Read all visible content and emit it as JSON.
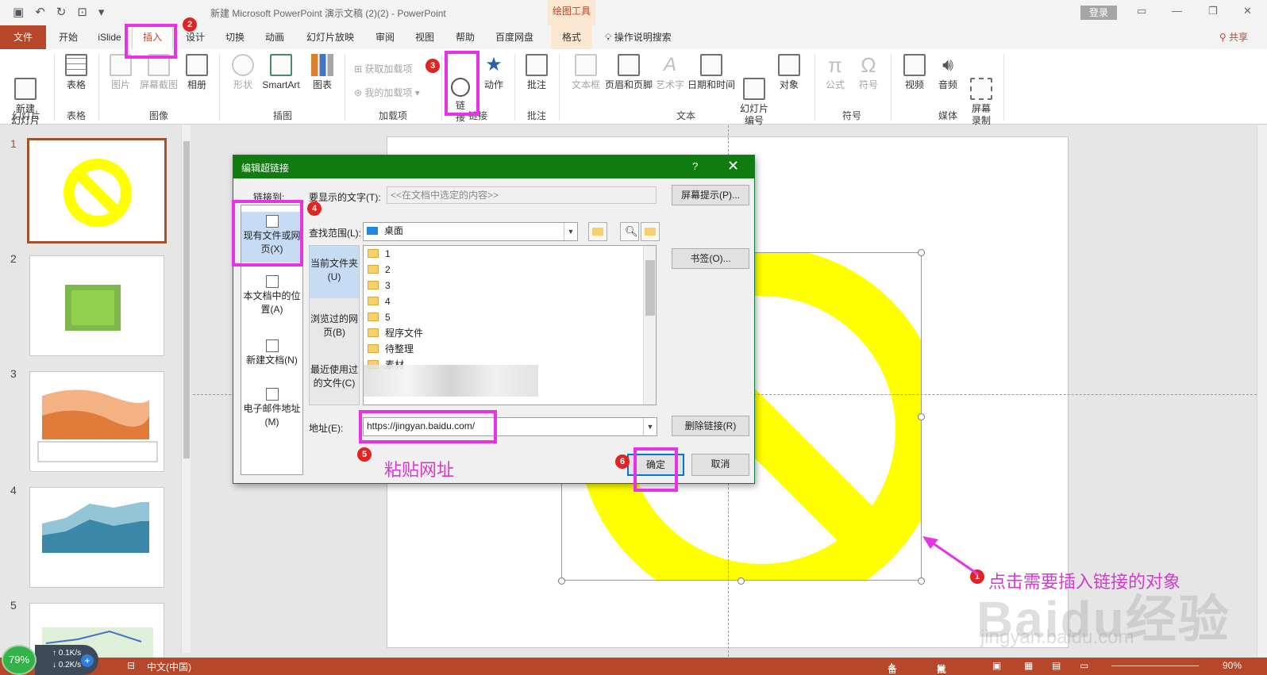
{
  "titlebar": {
    "title": "新建 Microsoft PowerPoint 演示文稿 (2)(2)  -  PowerPoint",
    "context_tab": "绘图工具",
    "login": "登录"
  },
  "tabs": [
    "文件",
    "开始",
    "iSlide",
    "插入",
    "设计",
    "切换",
    "动画",
    "幻灯片放映",
    "审阅",
    "视图",
    "帮助",
    "百度网盘",
    "格式"
  ],
  "tell_me": "操作说明搜索",
  "share": "共享",
  "ribbon": {
    "new_slide": "新建\n幻灯片",
    "table": "表格",
    "picture": "图片",
    "screenshot": "屏幕截图",
    "album": "相册",
    "shapes": "形状",
    "smartart": "SmartArt",
    "chart": "图表",
    "get_addins": "获取加载项",
    "my_addins": "我的加载项",
    "link": "链\n接",
    "action": "动作",
    "comment": "批注",
    "textbox": "文本框",
    "header_footer": "页眉和页脚",
    "wordart": "艺术字",
    "datetime": "日期和时间",
    "slide_number": "幻灯片\n编号",
    "object": "对象",
    "equation": "公式",
    "symbol": "符号",
    "video": "视频",
    "audio": "音频",
    "screen_record": "屏幕\n录制",
    "groups": [
      "幻灯片",
      "表格",
      "图像",
      "插图",
      "加载项",
      "链接",
      "批注",
      "文本",
      "符号",
      "媒体"
    ]
  },
  "thumbnails": [
    "1",
    "2",
    "3",
    "4",
    "5"
  ],
  "dialog": {
    "title": "编辑超链接",
    "help": "?",
    "close": "✕",
    "link_to_label": "链接到:",
    "link_to_items": [
      "现有文件或网页(X)",
      "本文档中的位置(A)",
      "新建文档(N)",
      "电子邮件地址(M)"
    ],
    "display_text_label": "要显示的文字(T):",
    "display_text_value": "<<在文档中选定的内容>>",
    "screentip_button": "屏幕提示(P)...",
    "look_in_label": "查找范围(L):",
    "look_in_value": "桌面",
    "nav_items": [
      "当前文件夹(U)",
      "浏览过的网页(B)",
      "最近使用过的文件(C)"
    ],
    "files": [
      "1",
      "2",
      "3",
      "4",
      "5",
      "程序文件",
      "待整理",
      "素材"
    ],
    "bookmark_button": "书签(O)...",
    "address_label": "地址(E):",
    "address_value": "https://jingyan.baidu.com/",
    "remove_link_button": "删除链接(R)",
    "ok_button": "确定",
    "cancel_button": "取消"
  },
  "annotations": {
    "badges": [
      "1",
      "2",
      "3",
      "4",
      "5",
      "6"
    ],
    "paste_note": "粘贴网址",
    "click_note": "点击需要插入链接的对象",
    "watermark": "Baidu经验",
    "watermark_url": "jingyan.baidu.com"
  },
  "statusbar": {
    "language": "中文(中国)",
    "notes": "备注",
    "comments": "批注",
    "zoom": "90%"
  },
  "speed_widget": {
    "percent": "79%",
    "up": "0.1K/s",
    "down": "0.2K/s"
  },
  "colors": {
    "accent": "#b7472a",
    "dialog_title": "#107c10",
    "annotation": "#e733e6",
    "shape_fill": "#ffff00"
  }
}
